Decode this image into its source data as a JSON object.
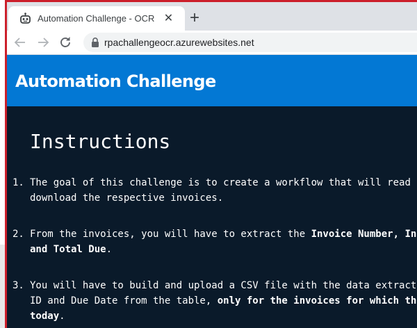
{
  "browser": {
    "tab": {
      "title": "Automation Challenge - OCR",
      "favicon": "robot-icon",
      "close_glyph": "✕"
    },
    "new_tab_glyph": "+",
    "address_bar": {
      "url": "rpachallengeocr.azurewebsites.net",
      "security": "lock-icon"
    },
    "nav": [
      "back-arrow-icon",
      "forward-arrow-icon",
      "reload-icon"
    ]
  },
  "site": {
    "title": "Automation Challenge",
    "header_color": "#0378d4",
    "background_color": "#0a1a2a"
  },
  "instructions": {
    "heading": "Instructions",
    "items": [
      {
        "number": "1.",
        "line1": "The goal of this challenge is to create a workflow that will read",
        "line2": "download the respective invoices."
      },
      {
        "number": "2.",
        "line1_a": "From the invoices, you will have to extract the ",
        "line1_b": "Invoice Number, In",
        "line2": "and Total Due",
        "line2_end": "."
      },
      {
        "number": "3.",
        "line1": "You will have to build and upload a CSV file with the data extract",
        "line2_a": "ID and Due Date from the table, ",
        "line2_b": "only for the invoices for which th",
        "line3_a": "today",
        "line3_b": "."
      }
    ]
  }
}
